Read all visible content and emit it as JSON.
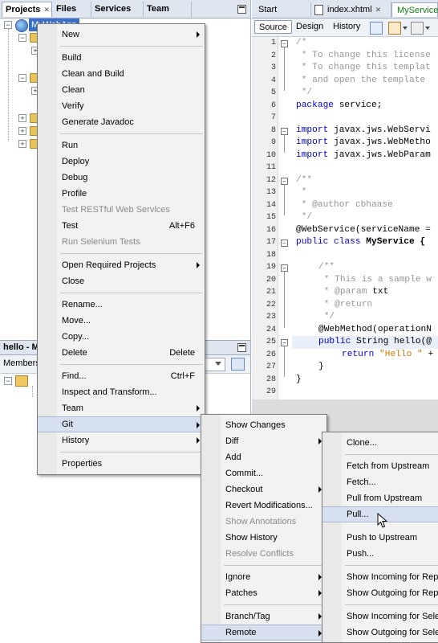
{
  "left_tabs": [
    "Projects",
    "Files",
    "Services",
    "Team"
  ],
  "project_node": "MyWebApp",
  "lower_panel": {
    "title": "hello - M",
    "members_label": "Members"
  },
  "editor_tabs": [
    "Start Page",
    "index.xhtml",
    "MyService."
  ],
  "editor_toolbar": {
    "source": "Source",
    "design": "Design",
    "history": "History"
  },
  "line_numbers": [
    "1",
    "2",
    "3",
    "4",
    "5",
    "6",
    "7",
    "8",
    "9",
    "10",
    "11",
    "12",
    "13",
    "14",
    "15",
    "16",
    "17",
    "18",
    "19",
    "20",
    "21",
    "22",
    "23",
    "24",
    "25",
    "26",
    "27",
    "28",
    "29"
  ],
  "code": {
    "l1": "/*",
    "l2": " * To change this license",
    "l3": " * To change this templat",
    "l4": " * and open the template",
    "l5": " */",
    "l6_kw": "package",
    "l6_rest": " service;",
    "l8_kw": "import",
    "l8_rest": " javax.jws.WebServi",
    "l9_kw": "import",
    "l9_rest": " javax.jws.WebMetho",
    "l10_kw": "import",
    "l10_rest": " javax.jws.WebParam",
    "l12": "/**",
    "l13": " *",
    "l14": " * @author cbhaase",
    "l15": " */",
    "l16": "@WebService(serviceName =",
    "l17_kw": "public class",
    "l17_rest": " MyService {",
    "l20": "/**",
    "l21": " * This is a sample w",
    "l22a": " * @param",
    "l22b": " txt",
    "l23": " * @return",
    "l24": " */",
    "l25": "@WebMethod(operationN",
    "l26_kw": "public",
    "l26_rest": " String hello(@",
    "l27_kw": "return",
    "l27_str": " \"Hello \"",
    "l27_rest": " +",
    "l28": "}",
    "l29": "}"
  },
  "context_menu": [
    {
      "label": "New",
      "submenu": true
    },
    {
      "sep": true
    },
    {
      "label": "Build"
    },
    {
      "label": "Clean and Build"
    },
    {
      "label": "Clean"
    },
    {
      "label": "Verify"
    },
    {
      "label": "Generate Javadoc"
    },
    {
      "sep": true
    },
    {
      "label": "Run"
    },
    {
      "label": "Deploy"
    },
    {
      "label": "Debug"
    },
    {
      "label": "Profile"
    },
    {
      "label": "Test RESTful Web Services",
      "disabled": true
    },
    {
      "label": "Test",
      "accel": "Alt+F6"
    },
    {
      "label": "Run Selenium Tests",
      "disabled": true
    },
    {
      "sep": true
    },
    {
      "label": "Open Required Projects",
      "submenu": true
    },
    {
      "label": "Close"
    },
    {
      "sep": true
    },
    {
      "label": "Rename..."
    },
    {
      "label": "Move..."
    },
    {
      "label": "Copy..."
    },
    {
      "label": "Delete",
      "accel": "Delete"
    },
    {
      "sep": true
    },
    {
      "label": "Find...",
      "accel": "Ctrl+F"
    },
    {
      "label": "Inspect and Transform..."
    },
    {
      "label": "Team",
      "submenu": true
    },
    {
      "label": "Git",
      "submenu": true,
      "selected": true
    },
    {
      "label": "History",
      "submenu": true
    },
    {
      "sep": true
    },
    {
      "label": "Properties"
    }
  ],
  "git_menu": [
    {
      "label": "Show Changes"
    },
    {
      "label": "Diff",
      "submenu": true
    },
    {
      "label": "Add"
    },
    {
      "label": "Commit..."
    },
    {
      "label": "Checkout",
      "submenu": true
    },
    {
      "label": "Revert Modifications..."
    },
    {
      "label": "Show Annotations",
      "disabled": true
    },
    {
      "label": "Show History"
    },
    {
      "label": "Resolve Conflicts",
      "disabled": true
    },
    {
      "sep": true
    },
    {
      "label": "Ignore",
      "submenu": true
    },
    {
      "label": "Patches",
      "submenu": true
    },
    {
      "sep": true
    },
    {
      "label": "Branch/Tag",
      "submenu": true
    },
    {
      "label": "Remote",
      "submenu": true,
      "selected": true
    }
  ],
  "remote_menu": [
    {
      "label": "Clone..."
    },
    {
      "sep": true
    },
    {
      "label": "Fetch from Upstream"
    },
    {
      "label": "Fetch..."
    },
    {
      "label": "Pull from Upstream"
    },
    {
      "label": "Pull...",
      "selected": true
    },
    {
      "label": "Push to Upstream"
    },
    {
      "label": "Push..."
    },
    {
      "sep": true
    },
    {
      "label": "Show Incoming for Rep"
    },
    {
      "label": "Show Outgoing for Rep"
    },
    {
      "sep": true
    },
    {
      "label": "Show Incoming for Sele"
    },
    {
      "label": "Show Outgoing for Sele"
    }
  ]
}
